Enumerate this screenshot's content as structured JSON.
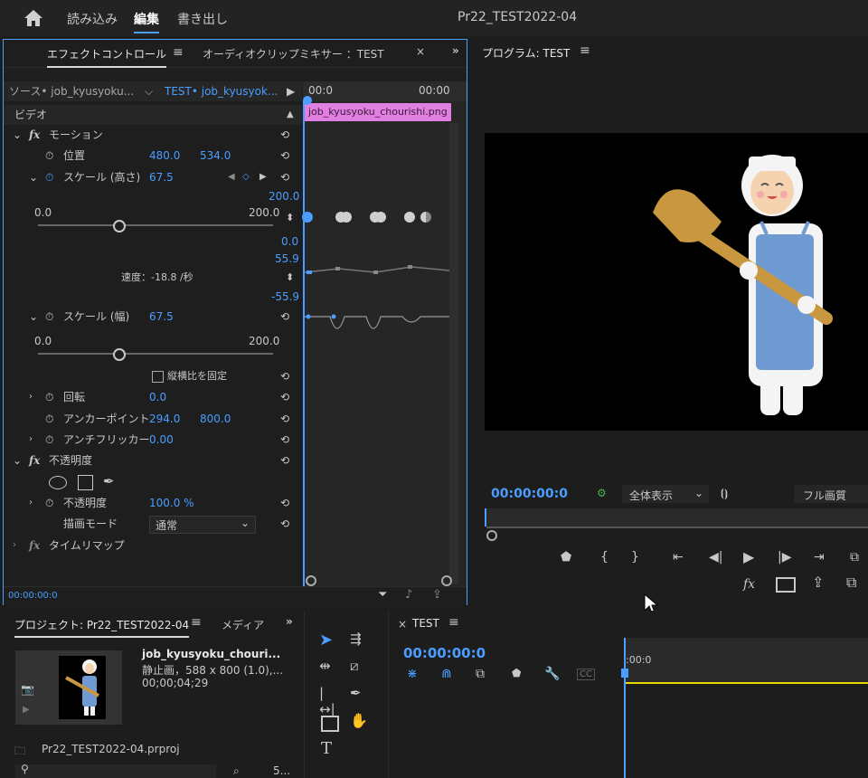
{
  "menu": {
    "items": [
      "読み込み",
      "編集",
      "書き出し"
    ],
    "title": "Pr22_TEST2022-04"
  },
  "effect_controls": {
    "tab_active": "エフェクトコントロール",
    "tab_other": "オーディオクリップミキサー ：TEST",
    "source_label": "ソース• job_kyusyoku...",
    "sequence_label": "TEST• job_kyusyok...",
    "timeline_start": "00:0",
    "timeline_end": "00:00",
    "clip_name": "job_kyusyoku_chourishi.png",
    "video_header": "ビデオ",
    "motion": "モーション",
    "position_label": "位置",
    "position_x": "480.0",
    "position_y": "534.0",
    "scale_height_label": "スケール (高さ)",
    "scale_height_value": "67.5",
    "graph_max": "200.0",
    "slider_min": "0.0",
    "slider_max": "200.0",
    "graph_zero": "0.0",
    "velocity_top": "55.9",
    "velocity_label": "速度：-18.8 /秒",
    "velocity_bottom": "-55.9",
    "scale_width_label": "スケール (幅)",
    "scale_width_value": "67.5",
    "slider2_min": "0.0",
    "slider2_max": "200.0",
    "uniform_scale": "縦横比を固定",
    "rotation_label": "回転",
    "rotation_value": "0.0",
    "anchor_label": "アンカーポイント",
    "anchor_x": "294.0",
    "anchor_y": "800.0",
    "antiflicker_label": "アンチフリッカー",
    "antiflicker_value": "0.00",
    "opacity_header": "不透明度",
    "opacity_label": "不透明度",
    "opacity_value": "100.0 %",
    "blend_label": "描画モード",
    "blend_value": "通常",
    "timeremap_label": "タイムリマップ",
    "footer_time": "00:00:00:0"
  },
  "program": {
    "title": "プログラム: TEST",
    "timecode": "00:00:00:0",
    "zoom": "全体表示",
    "quality": "フル画質"
  },
  "project": {
    "title": "プロジェクト: Pr22_TEST2022-04",
    "media_tab": "メディア",
    "clip_name": "job_kyusyoku_chouri...",
    "clip_info1": "静止画，588 x 800 (1.0),...",
    "clip_info2": "00;00;04;29",
    "project_file": "Pr22_TEST2022-04.prproj",
    "count": "5..."
  },
  "timeline": {
    "tab": "TEST",
    "timecode": "00:00:00:0",
    "ruler_start": ":00:0"
  },
  "colors": {
    "accent": "#4a9eff",
    "clip_label": "#e07fe0"
  }
}
